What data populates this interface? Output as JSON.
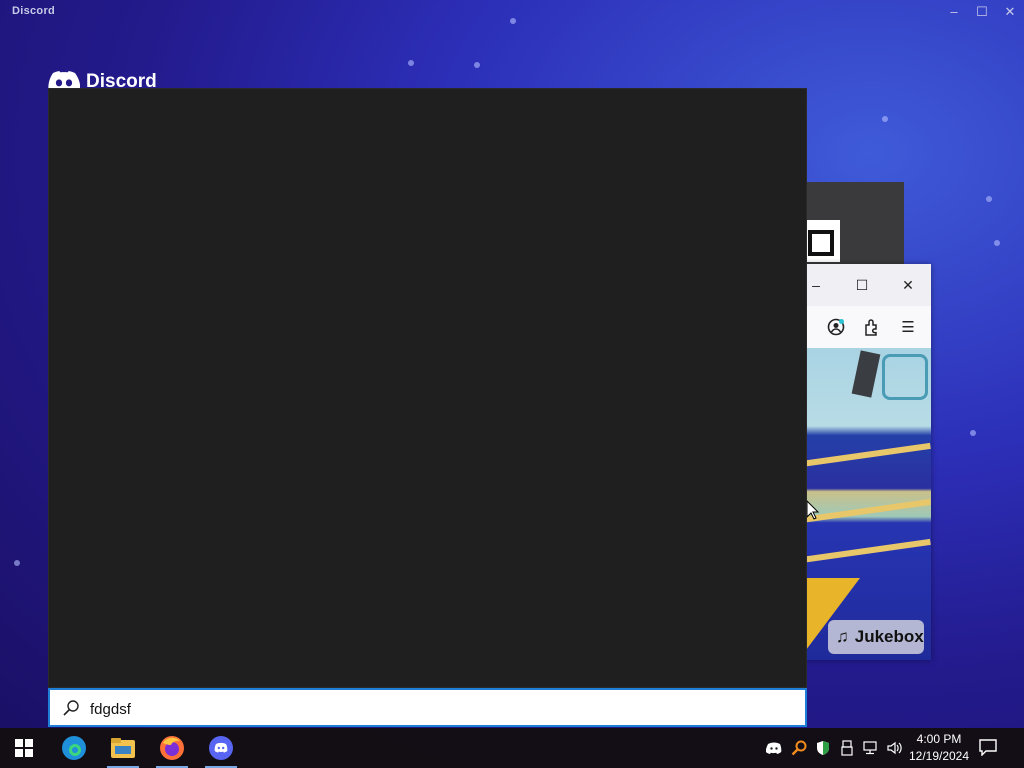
{
  "app": {
    "title": "Discord",
    "logo_text": "Discord"
  },
  "search": {
    "value": "fdgdsf"
  },
  "browser": {
    "jukebox_label": "Jukebox"
  },
  "taskbar": {
    "apps": [
      "start-icon",
      "edge-icon",
      "file-explorer-icon",
      "firefox-icon",
      "discord-icon"
    ],
    "tray_icons": [
      "discord-tray-icon",
      "search-tray-icon",
      "shield-tray-icon",
      "usb-tray-icon",
      "network-icon",
      "volume-icon"
    ],
    "time": "4:00 PM",
    "date": "12/19/2024"
  },
  "colors": {
    "search_border": "#1f7fd6",
    "panel_bg": "#1f1f1f",
    "discord_blurple": "#5865f2"
  }
}
